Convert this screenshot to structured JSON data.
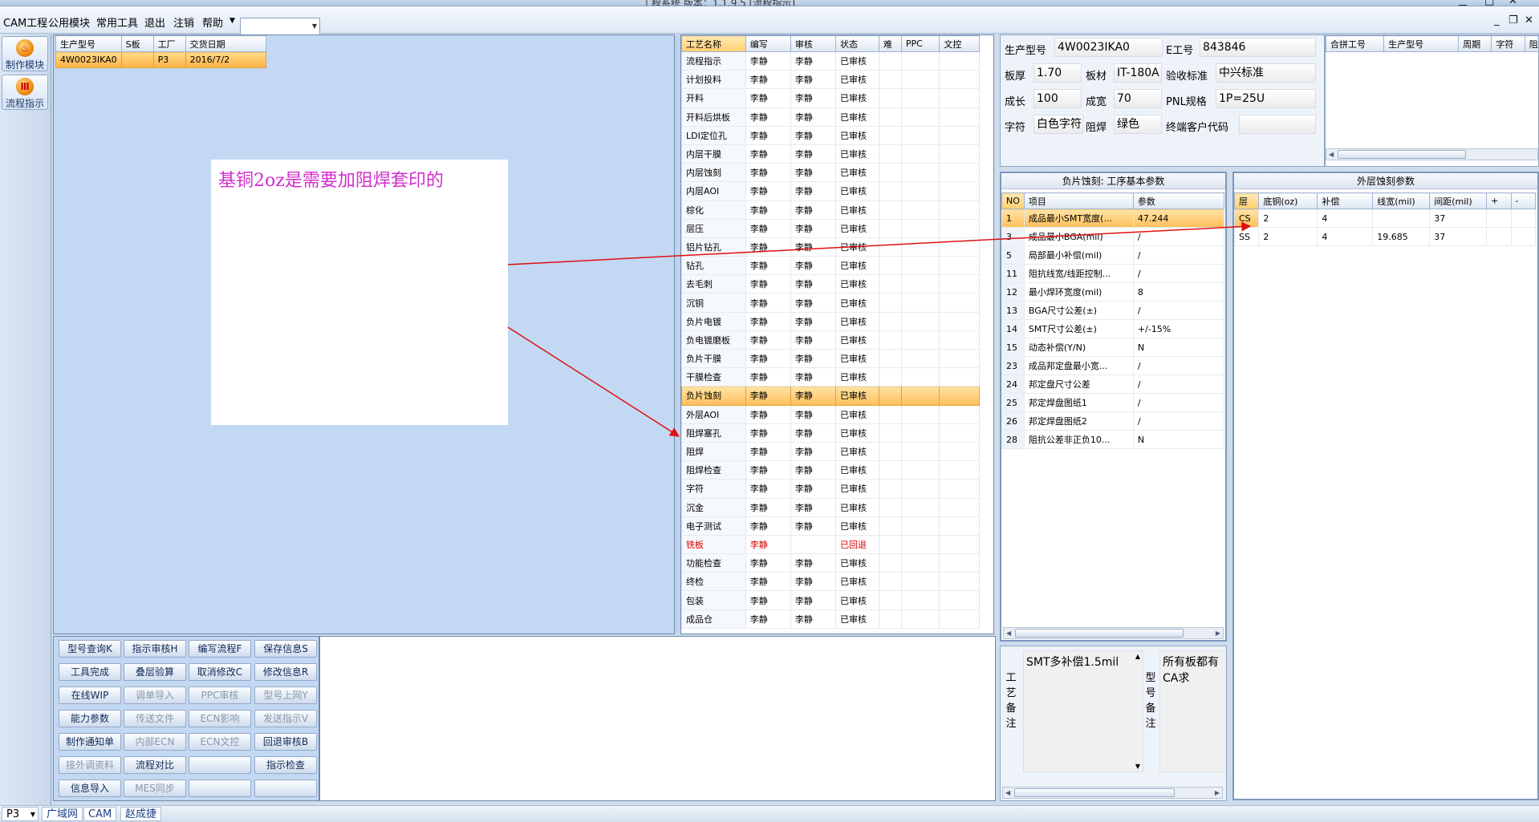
{
  "window": {
    "title": "工程系统  版本：1.1.9.5  [流程指示]"
  },
  "menu": {
    "items": [
      "CAM工程",
      "公用模块",
      "常用工具",
      "退出",
      "注销",
      "帮助"
    ],
    "combo_value": ""
  },
  "sidebar": {
    "items": [
      {
        "label": "制作模块",
        "icon": "fire-icon"
      },
      {
        "label": "流程指示",
        "icon": "flow-icon"
      }
    ]
  },
  "orders": {
    "columns": [
      "生产型号",
      "S板",
      "工厂",
      "交货日期"
    ],
    "rows": [
      [
        "4W0023IKA0",
        "",
        "P3",
        "2016/7/2"
      ]
    ]
  },
  "note": {
    "text": "基铜2oz是需要加阻焊套印的"
  },
  "process": {
    "columns": [
      "工艺名称",
      "编写",
      "审核",
      "状态",
      "难",
      "PPC",
      "文控"
    ],
    "rows": [
      [
        "流程指示",
        "李静",
        "李静",
        "已审核",
        "",
        "",
        ""
      ],
      [
        "计划投料",
        "李静",
        "李静",
        "已审核",
        "",
        "",
        ""
      ],
      [
        "开料",
        "李静",
        "李静",
        "已审核",
        "",
        "",
        ""
      ],
      [
        "开料后烘板",
        "李静",
        "李静",
        "已审核",
        "",
        "",
        ""
      ],
      [
        "LDI定位孔",
        "李静",
        "李静",
        "已审核",
        "",
        "",
        ""
      ],
      [
        "内层干膜",
        "李静",
        "李静",
        "已审核",
        "",
        "",
        ""
      ],
      [
        "内层蚀刻",
        "李静",
        "李静",
        "已审核",
        "",
        "",
        ""
      ],
      [
        "内层AOI",
        "李静",
        "李静",
        "已审核",
        "",
        "",
        ""
      ],
      [
        "棕化",
        "李静",
        "李静",
        "已审核",
        "",
        "",
        ""
      ],
      [
        "层压",
        "李静",
        "李静",
        "已审核",
        "",
        "",
        ""
      ],
      [
        "铝片钻孔",
        "李静",
        "李静",
        "已审核",
        "",
        "",
        ""
      ],
      [
        "钻孔",
        "李静",
        "李静",
        "已审核",
        "",
        "",
        ""
      ],
      [
        "去毛刺",
        "李静",
        "李静",
        "已审核",
        "",
        "",
        ""
      ],
      [
        "沉铜",
        "李静",
        "李静",
        "已审核",
        "",
        "",
        ""
      ],
      [
        "负片电镀",
        "李静",
        "李静",
        "已审核",
        "",
        "",
        ""
      ],
      [
        "负电镀磨板",
        "李静",
        "李静",
        "已审核",
        "",
        "",
        ""
      ],
      [
        "负片干膜",
        "李静",
        "李静",
        "已审核",
        "",
        "",
        ""
      ],
      [
        "干膜检查",
        "李静",
        "李静",
        "已审核",
        "",
        "",
        ""
      ],
      [
        "负片蚀刻",
        "李静",
        "李静",
        "已审核",
        "",
        "",
        ""
      ],
      [
        "外层AOI",
        "李静",
        "李静",
        "已审核",
        "",
        "",
        ""
      ],
      [
        "阻焊塞孔",
        "李静",
        "李静",
        "已审核",
        "",
        "",
        ""
      ],
      [
        "阻焊",
        "李静",
        "李静",
        "已审核",
        "",
        "",
        ""
      ],
      [
        "阻焊检查",
        "李静",
        "李静",
        "已审核",
        "",
        "",
        ""
      ],
      [
        "字符",
        "李静",
        "李静",
        "已审核",
        "",
        "",
        ""
      ],
      [
        "沉金",
        "李静",
        "李静",
        "已审核",
        "",
        "",
        ""
      ],
      [
        "电子测试",
        "李静",
        "李静",
        "已审核",
        "",
        "",
        ""
      ],
      [
        "铣板",
        "李静",
        "",
        "已回退",
        "",
        "",
        ""
      ],
      [
        "功能检查",
        "李静",
        "李静",
        "已审核",
        "",
        "",
        ""
      ],
      [
        "终检",
        "李静",
        "李静",
        "已审核",
        "",
        "",
        ""
      ],
      [
        "包装",
        "李静",
        "李静",
        "已审核",
        "",
        "",
        ""
      ],
      [
        "成品仓",
        "李静",
        "李静",
        "已审核",
        "",
        "",
        ""
      ]
    ],
    "selected_index": 18,
    "returned_index": 26,
    "returned_color": "#dd0000"
  },
  "info": {
    "model_label": "生产型号",
    "model": "4W0023IKA0",
    "e_no_label": "E工号",
    "e_no": "843846",
    "thickness_label": "板厚",
    "thickness": "1.70",
    "material_label": "板材",
    "material": "IT-180A",
    "standard_label": "验收标准",
    "standard": "中兴标准",
    "length_label": "成长",
    "length": "100",
    "width_label": "成宽",
    "width": "70",
    "pnl_label": "PNL规格",
    "pnl": "1P=25U",
    "char_label": "字符",
    "char": "白色字符",
    "mask_label": "阻焊",
    "mask": "绿色",
    "customer_label": "终端客户代码",
    "customer": ""
  },
  "merge": {
    "columns": [
      "合拼工号",
      "生产型号",
      "周期",
      "字符",
      "阻焊"
    ]
  },
  "params": {
    "title": "负片蚀刻: 工序基本参数",
    "columns": [
      "NO",
      "项目",
      "参数"
    ],
    "rows": [
      [
        "1",
        "成品最小SMT宽度(...",
        "47.244"
      ],
      [
        "3",
        "成品最小BGA(mil)",
        "/"
      ],
      [
        "5",
        "局部最小补偿(mil)",
        "/"
      ],
      [
        "11",
        "阻抗线宽/线距控制...",
        "/"
      ],
      [
        "12",
        "最小焊环宽度(mil)",
        "8"
      ],
      [
        "13",
        "BGA尺寸公差(±)",
        "/"
      ],
      [
        "14",
        "SMT尺寸公差(±)",
        "+/-15%"
      ],
      [
        "15",
        "动态补偿(Y/N)",
        "N"
      ],
      [
        "23",
        "成品邦定盘最小宽...",
        "/"
      ],
      [
        "24",
        "邦定盘尺寸公差",
        "/"
      ],
      [
        "25",
        "邦定焊盘图纸1",
        "/"
      ],
      [
        "26",
        "邦定焊盘图纸2",
        "/"
      ],
      [
        "28",
        "阻抗公差非正负10...",
        "N"
      ]
    ]
  },
  "outer": {
    "title": "外层蚀刻参数",
    "columns": [
      "层",
      "底铜(oz)",
      "补偿",
      "线宽(mil)",
      "间距(mil)",
      "+",
      "-"
    ],
    "rows": [
      [
        "CS",
        "2",
        "4",
        "",
        "37",
        "",
        ""
      ],
      [
        "SS",
        "2",
        "4",
        "19.685",
        "37",
        "",
        ""
      ]
    ]
  },
  "buttons": [
    [
      "型号查询K",
      "指示审核H",
      "编写流程F",
      "保存信息S"
    ],
    [
      "工具完成",
      "叠层验算",
      "取消修改C",
      "修改信息R"
    ],
    [
      "在线WIP",
      "调单导入",
      "PPC审核",
      "型号上网Y"
    ],
    [
      "能力参数",
      "传送文件",
      "ECN影响",
      "发送指示V"
    ],
    [
      "制作通知单",
      "内部ECN",
      "ECN文控",
      "回退审核B"
    ],
    [
      "接外调资料",
      "流程对比",
      "",
      "指示检查"
    ],
    [
      "信息导入",
      "MES同步",
      "",
      ""
    ]
  ],
  "disabled_buttons": [
    "调单导入",
    "PPC审核",
    "型号上网Y",
    "传送文件",
    "ECN影响",
    "发送指示V",
    "内部ECN",
    "ECN文控",
    "接外调资料",
    "MES同步"
  ],
  "remarks": {
    "process_label": "工艺备注",
    "process_text": "SMT多补偿1.5mil",
    "model_label": "型号备注",
    "model_text": "所有板都有CA求"
  },
  "status": {
    "factory": "P3",
    "network": "广域网",
    "module": "CAM",
    "user": "赵成捷"
  },
  "colors": {
    "accent": "#ffbf5a",
    "panel": "#c3d8f2",
    "arrow": "#e01010",
    "note_text": "#d22ecc"
  }
}
